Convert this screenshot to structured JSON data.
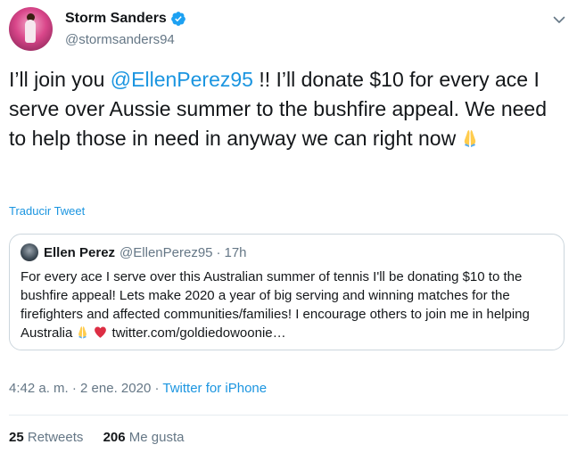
{
  "tweet": {
    "author": {
      "name": "Storm Sanders",
      "handle": "@stormsanders94"
    },
    "text_parts": {
      "t1": "I’ll join you ",
      "mention": "@EllenPerez95",
      "t2": " !! I’ll donate $10 for every ace I serve over Aussie summer to the bushfire appeal. We need to help those in need in anyway we can right now"
    },
    "translate_label": "Traducir Tweet",
    "timestamp": {
      "time": "4:42 a. m.",
      "sep1": "·",
      "date": "2 ene. 2020",
      "sep2": "·",
      "source": "Twitter for iPhone"
    },
    "stats": {
      "retweets_count": "25",
      "retweets_label": "Retweets",
      "likes_count": "206",
      "likes_label": "Me gusta"
    }
  },
  "quoted_tweet": {
    "name": "Ellen Perez",
    "handle": "@EllenPerez95",
    "separator": "·",
    "time": "17h",
    "text": "For every ace I serve over this Australian summer of tennis I'll be donating $10 to the bushfire appeal! Lets make 2020 a year of big serving and winning matches for the firefighters and affected communities/families! I encourage others to join me in helping Australia",
    "link": "twitter.com/goldiedowoonie…"
  },
  "icons": {
    "verified": "verified-badge-icon",
    "menu": "chevron-down-icon",
    "pray": "folded-hands-emoji",
    "heart": "red-heart-emoji"
  },
  "colors": {
    "link": "#1b95e0",
    "secondary_text": "#657786",
    "border": "#ccd6dd",
    "verified": "#1da1f2",
    "heart": "#e0245e"
  }
}
